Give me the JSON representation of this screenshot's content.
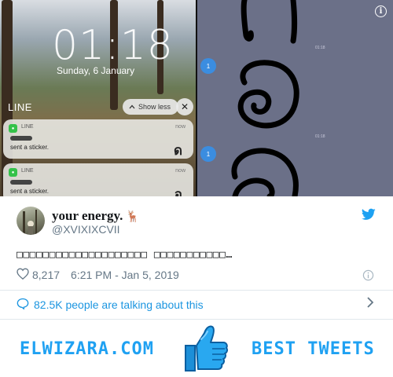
{
  "lockscreen": {
    "time": "01:18",
    "date": "Sunday, 6 January",
    "group_label": "LINE",
    "show_less": "Show less",
    "notifications": [
      {
        "app": "LINE",
        "when": "now",
        "message": "sent a sticker.",
        "sticker": "ด"
      },
      {
        "app": "LINE",
        "when": "now",
        "message": "sent a sticker.",
        "sticker": "อ"
      }
    ]
  },
  "chat": {
    "avatar_label": "1",
    "times": [
      "01:18",
      "01:18"
    ]
  },
  "tweet": {
    "author": "your energy.",
    "author_emoji": "🦌",
    "handle": "@XVIXIXCVII",
    "text": "□□□□□□□□□□□□□□□□□□□□ □□□□□□□□□□□…",
    "likes": "8,217",
    "timestamp": "6:21 PM - Jan 5, 2019",
    "talking": "82.5K people are talking about this"
  },
  "footer": {
    "left_brand": "ELWIZARA.COM",
    "right_brand": "BEST TWEETS"
  },
  "colors": {
    "twitter_blue": "#1da1f2",
    "link_blue": "#1b95e0",
    "brand_blue": "#1fa1f2",
    "meta_gray": "#657786"
  },
  "icons": [
    "info-icon",
    "twitter-bird-icon",
    "heart-icon",
    "info-circle-icon",
    "chat-bubble-icon",
    "chevron-right-icon",
    "thumbs-up-icon",
    "chevron-up-icon",
    "close-icon"
  ]
}
